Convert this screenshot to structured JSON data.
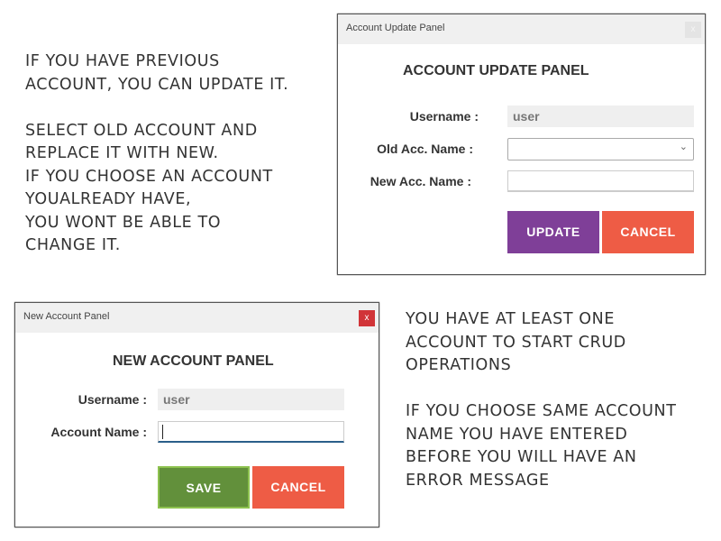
{
  "notes": {
    "top_left": "IF YOU HAVE PREVIOUS\nACCOUNT, YOU CAN UPDATE IT.\n\nSELECT OLD ACCOUNT AND\nREPLACE IT WITH NEW.\nIF YOU CHOOSE AN ACCOUNT\nYOUALREADY HAVE,\nYOU WONT BE ABLE TO\nCHANGE IT.",
    "bottom_right": "YOU HAVE AT LEAST ONE\nACCOUNT TO START CRUD\nOPERATIONS\n\nIF YOU CHOOSE SAME ACCOUNT\nNAME YOU HAVE ENTERED\nBEFORE YOU WILL HAVE AN\nERROR MESSAGE"
  },
  "update_panel": {
    "window_title": "Account Update Panel",
    "close_icon": "x",
    "heading": "ACCOUNT UPDATE PANEL",
    "username_label": "Username :",
    "username_value": "user",
    "old_acc_label": "Old Acc. Name :",
    "old_acc_value": "",
    "new_acc_label": "New Acc. Name :",
    "new_acc_value": "",
    "update_label": "UPDATE",
    "cancel_label": "CANCEL",
    "colors": {
      "update": "#7f3f98",
      "cancel": "#ee5c45"
    }
  },
  "new_panel": {
    "window_title": "New Account Panel",
    "close_icon": "x",
    "heading": "NEW ACCOUNT PANEL",
    "username_label": "Username :",
    "username_value": "user",
    "account_label": "Account Name :",
    "account_value": "",
    "save_label": "SAVE",
    "cancel_label": "CANCEL",
    "colors": {
      "save": "#62903b",
      "cancel": "#ee5c45",
      "close": "#d13438"
    }
  }
}
